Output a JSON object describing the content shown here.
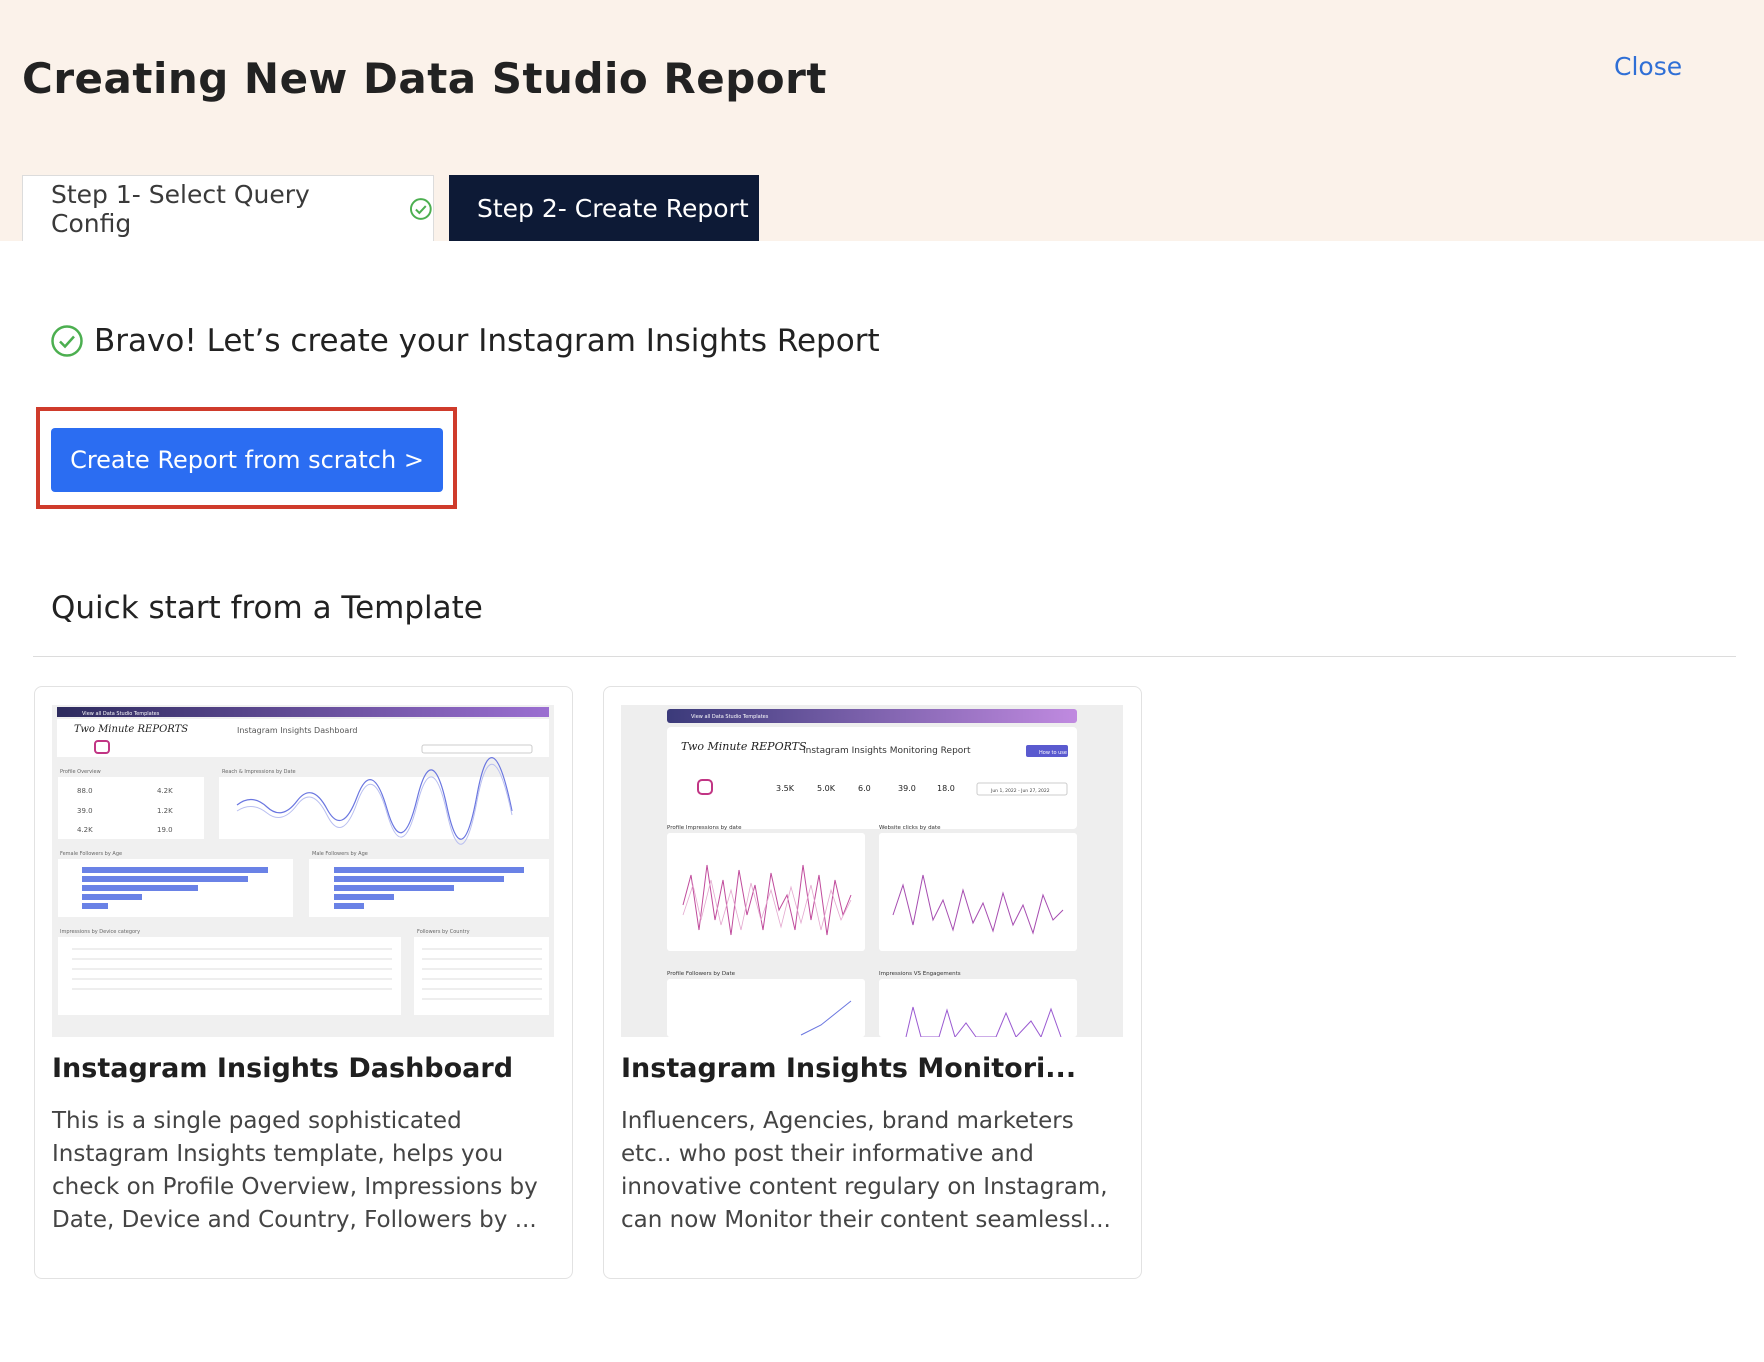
{
  "header": {
    "title": "Creating New Data Studio Report",
    "close_label": "Close"
  },
  "steps": [
    {
      "label": "Step 1- Select Query Config",
      "completed": true
    },
    {
      "label": "Step 2- Create Report",
      "active": true
    }
  ],
  "bravo_text": "Bravo! Let’s create your Instagram Insights Report",
  "create_button_label": "Create Report from scratch >",
  "quick_start_title": "Quick start from a Template",
  "templates": [
    {
      "title": "Instagram Insights Dashboard",
      "description": "This is a single paged sophisticated Instagram Insights template, helps you check on Profile Overview, Impressions by Date, Device and Country, Followers by ...",
      "thumb": {
        "banner": "View all Data Studio Templates",
        "logo": "Two Minute REPORTS",
        "heading": "Instagram Insights Dashboard",
        "kpis": [
          "88.0",
          "4.2K",
          "39.0",
          "1.2K",
          "4.2K",
          "19.0"
        ],
        "panels": [
          "Profile Overview",
          "Reach & Impressions by Date",
          "Female Followers by Age",
          "Male Followers by Age",
          "Impressions by Device category",
          "Followers by Country"
        ]
      }
    },
    {
      "title": "Instagram Insights Monitori...",
      "description": "Influencers, Agencies, brand marketers etc.. who post their informative and innovative content regulary on Instagram, can now Monitor their content seamlessl...",
      "thumb": {
        "banner": "View all Data Studio Templates",
        "logo": "Two Minute REPORTS",
        "heading": "Instagram Insights Monitoring Report",
        "how_to": "How to use",
        "kpis": [
          "3.5K",
          "5.0K",
          "6.0",
          "39.0",
          "18.0"
        ],
        "date_range": "Jun 1, 2022 - Jun 27, 2022",
        "panels": [
          "Profile Impressions by date",
          "Website clicks by date",
          "Profile Followers by Date",
          "Impressions VS Engagements"
        ]
      }
    }
  ],
  "colors": {
    "header_bg": "#fbf2ea",
    "active_tab": "#0d1a36",
    "primary_button": "#2b6df2",
    "highlight": "#cf3b2b",
    "check_green": "#4caf50",
    "link": "#2f6fd6"
  }
}
